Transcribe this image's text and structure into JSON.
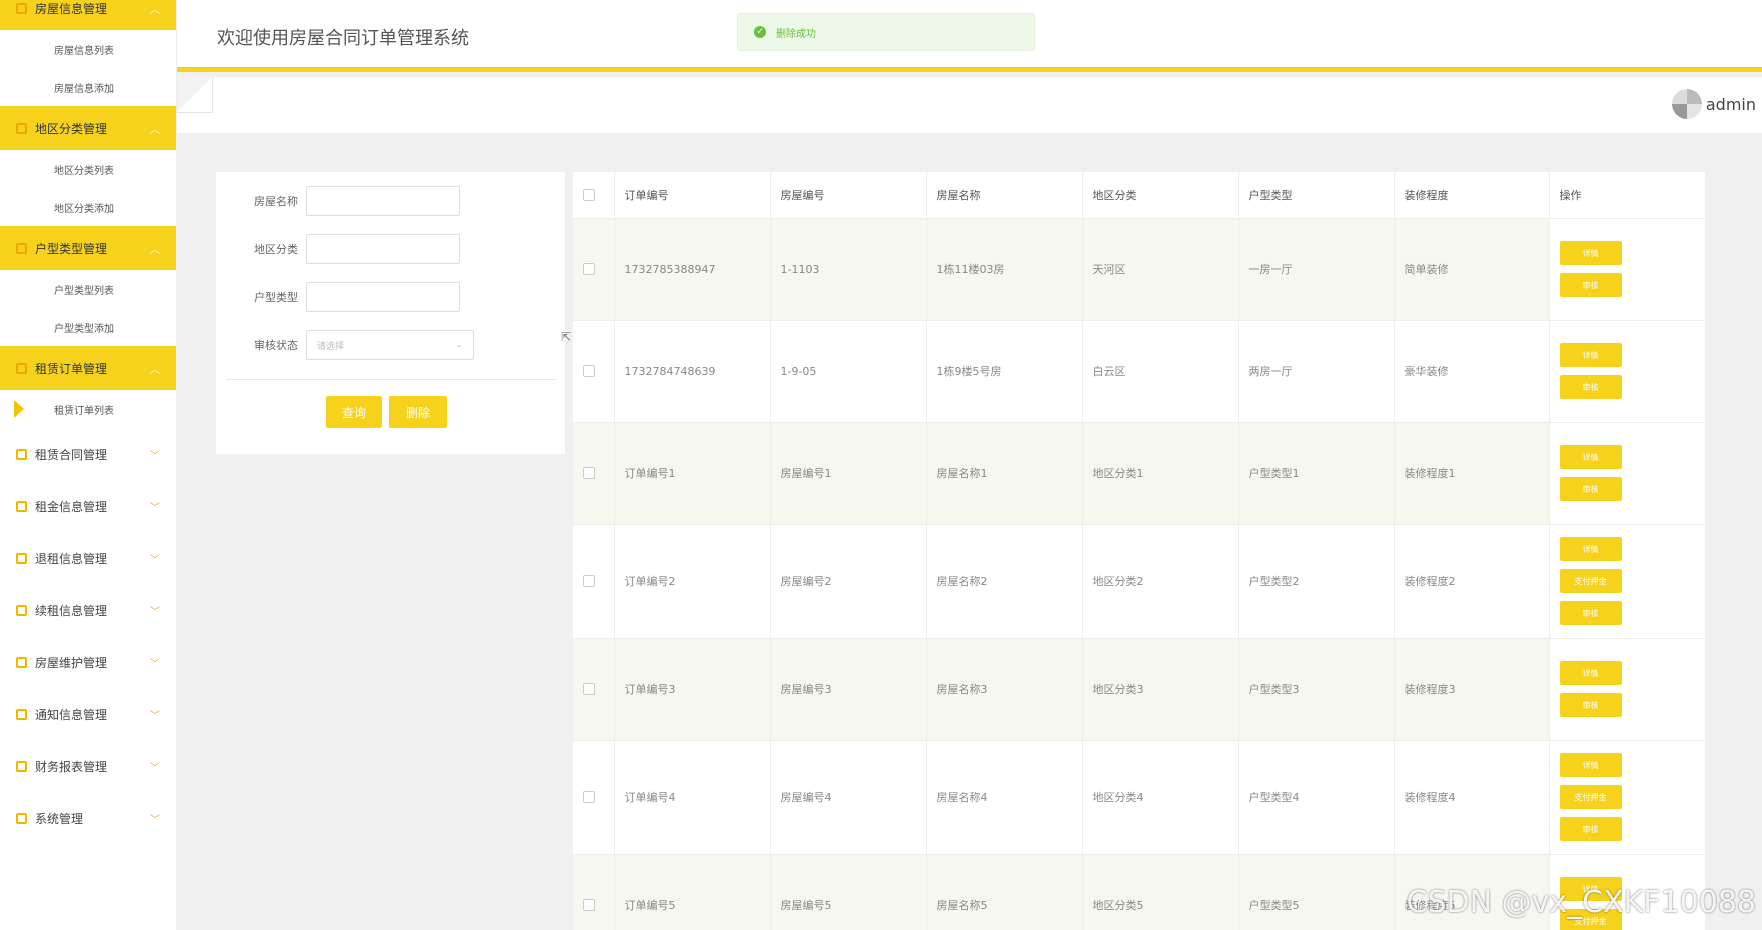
{
  "sidebar": {
    "groups": [
      {
        "label": "房屋信息管理",
        "open": true,
        "subs": [
          "房屋信息列表",
          "房屋信息添加"
        ]
      },
      {
        "label": "地区分类管理",
        "open": true,
        "subs": [
          "地区分类列表",
          "地区分类添加"
        ]
      },
      {
        "label": "户型类型管理",
        "open": true,
        "subs": [
          "户型类型列表",
          "户型类型添加"
        ]
      },
      {
        "label": "租赁订单管理",
        "open": true,
        "subs": [
          "租赁订单列表"
        ]
      },
      {
        "label": "租赁合同管理",
        "open": false,
        "subs": []
      },
      {
        "label": "租金信息管理",
        "open": false,
        "subs": []
      },
      {
        "label": "退租信息管理",
        "open": false,
        "subs": []
      },
      {
        "label": "续租信息管理",
        "open": false,
        "subs": []
      },
      {
        "label": "房屋维护管理",
        "open": false,
        "subs": []
      },
      {
        "label": "通知信息管理",
        "open": false,
        "subs": []
      },
      {
        "label": "财务报表管理",
        "open": false,
        "subs": []
      },
      {
        "label": "系统管理",
        "open": false,
        "subs": []
      }
    ]
  },
  "header": {
    "title": "欢迎使用房屋合同订单管理系统",
    "toast": "删除成功",
    "username": "admin"
  },
  "search": {
    "fields": [
      "房屋名称",
      "地区分类",
      "户型类型",
      "审核状态"
    ],
    "select_placeholder": "请选择",
    "query_label": "查询",
    "delete_label": "删除"
  },
  "table": {
    "columns": [
      "订单编号",
      "房屋编号",
      "房屋名称",
      "地区分类",
      "户型类型",
      "装修程度",
      "操作"
    ],
    "rows": [
      {
        "cells": [
          "1732785388947",
          "1-1103",
          "1栋11楼03房",
          "天河区",
          "一房一厅",
          "简单装修"
        ],
        "ops": [
          "详情",
          "审核"
        ]
      },
      {
        "cells": [
          "1732784748639",
          "1-9-05",
          "1栋9楼5号房",
          "白云区",
          "两房一厅",
          "豪华装修"
        ],
        "ops": [
          "详情",
          "审核"
        ]
      },
      {
        "cells": [
          "订单编号1",
          "房屋编号1",
          "房屋名称1",
          "地区分类1",
          "户型类型1",
          "装修程度1"
        ],
        "ops": [
          "详情",
          "审核"
        ]
      },
      {
        "cells": [
          "订单编号2",
          "房屋编号2",
          "房屋名称2",
          "地区分类2",
          "户型类型2",
          "装修程度2"
        ],
        "ops": [
          "详情",
          "支付押金",
          "审核"
        ]
      },
      {
        "cells": [
          "订单编号3",
          "房屋编号3",
          "房屋名称3",
          "地区分类3",
          "户型类型3",
          "装修程度3"
        ],
        "ops": [
          "详情",
          "审核"
        ]
      },
      {
        "cells": [
          "订单编号4",
          "房屋编号4",
          "房屋名称4",
          "地区分类4",
          "户型类型4",
          "装修程度4"
        ],
        "ops": [
          "详情",
          "支付押金",
          "审核"
        ]
      },
      {
        "cells": [
          "订单编号5",
          "房屋编号5",
          "房屋名称5",
          "地区分类5",
          "户型类型5",
          "装修程度5"
        ],
        "ops": [
          "详情",
          "支付押金"
        ]
      }
    ]
  },
  "watermark": "CSDN @vx_CXKF10088",
  "colors": {
    "accent": "#f7d21c",
    "success": "#67c23a"
  }
}
